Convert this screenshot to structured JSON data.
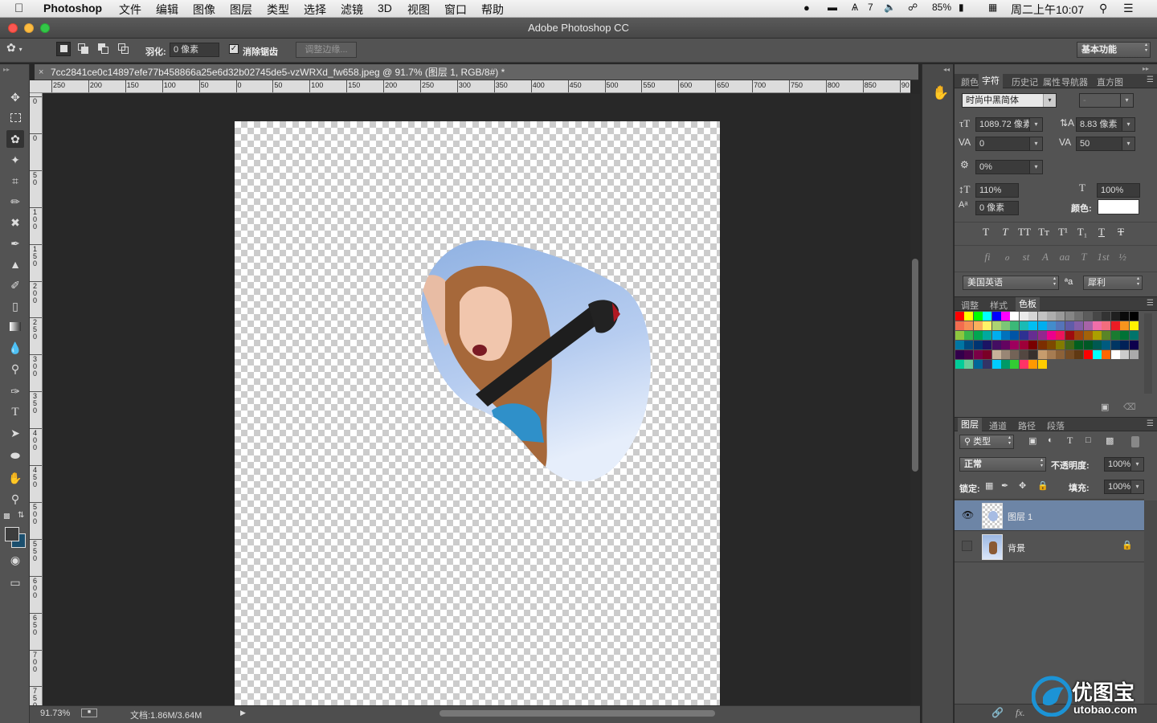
{
  "menubar": {
    "app_name": "Photoshop",
    "menus": [
      "文件",
      "编辑",
      "图像",
      "图层",
      "类型",
      "选择",
      "滤镜",
      "3D",
      "视图",
      "窗口",
      "帮助"
    ],
    "input_method": "7",
    "battery": "85%",
    "clock": "周二上午10:07"
  },
  "window": {
    "title": "Adobe Photoshop CC"
  },
  "options": {
    "feather_label": "羽化:",
    "feather_value": "0 像素",
    "antialias_label": "消除锯齿",
    "refine_edge_label": "调整边缘...",
    "workspace": "基本功能"
  },
  "document": {
    "tab_title": "7cc2841ce0c14897efe77b458866a25e6d32b02745de5-vzWRXd_fw658.jpeg @ 91.7% (图层 1, RGB/8#) *",
    "zoom": "91.73%",
    "doc_size": "文档:1.86M/3.64M"
  },
  "ruler": {
    "h_ticks": [
      "250",
      "200",
      "150",
      "100",
      "50",
      "0",
      "50",
      "100",
      "150",
      "200",
      "250",
      "300",
      "350",
      "400",
      "450",
      "500",
      "550",
      "600",
      "650",
      "700",
      "750",
      "800",
      "850",
      "90"
    ],
    "v_ticks": [
      "0",
      "0",
      "5\n0",
      "1\n0\n0",
      "1\n5\n0",
      "2\n0\n0",
      "2\n5\n0",
      "3\n0\n0",
      "3\n5\n0",
      "4\n0\n0",
      "4\n5\n0",
      "5\n0\n0",
      "5\n5\n0",
      "6\n0\n0",
      "6\n5\n0",
      "7\n0\n0",
      "7\n5\n0"
    ]
  },
  "character_panel": {
    "tabs": [
      "颜色",
      "字符",
      "历史记",
      "属性",
      "导航器",
      "直方图"
    ],
    "font_family": "时尚中黑简体",
    "font_style": "-",
    "font_size": "1089.72 像素",
    "leading": "8.83 像素",
    "kerning": "0",
    "tracking": "50",
    "tsume": "0%",
    "vertical_scale": "110%",
    "horizontal_scale": "100%",
    "baseline_shift": "0 像素",
    "color_label": "颜色:",
    "text_color": "#ffffff",
    "style_buttons": [
      "T",
      "T",
      "TT",
      "Tт",
      "T¹",
      "T₁",
      "T",
      "T"
    ],
    "opentype_buttons": [
      "fi",
      "ℴ",
      "st",
      "A",
      "aa",
      "T",
      "1st",
      "½"
    ],
    "language": "美国英语",
    "aa_icon": "ªa",
    "antialias": "犀利"
  },
  "swatches_panel": {
    "tabs": [
      "调整",
      "样式",
      "色板"
    ],
    "colors": [
      [
        "#ff0000",
        "#ffff00",
        "#00ff00",
        "#00ffff",
        "#0000ff",
        "#ff00ff",
        "#ffffff",
        "#ebebeb",
        "#d6d6d6",
        "#c2c2c2",
        "#adadad",
        "#999999",
        "#858585",
        "#707070",
        "#5c5c5c",
        "#474747",
        "#333333",
        "#1f1f1f",
        "#0a0a0a",
        "#000000"
      ],
      [
        "#f26c4f",
        "#f68e55",
        "#fbaf5c",
        "#fff467",
        "#acd372",
        "#7cc576",
        "#3bb878",
        "#1abbb4",
        "#00bff3",
        "#00aeef",
        "#438ccb",
        "#5574b9",
        "#605ca8",
        "#855fa8",
        "#a763a8",
        "#f06ea9",
        "#f26d7d",
        "#ed1c24",
        "#f7941d",
        "#fff200"
      ],
      [
        "#8dc63f",
        "#39b54a",
        "#00a651",
        "#00a99d",
        "#00aeef",
        "#0072bc",
        "#0054a6",
        "#2e3192",
        "#662d91",
        "#92278f",
        "#ec008c",
        "#ed145b",
        "#9e0b0f",
        "#a0410d",
        "#a36209",
        "#aba000",
        "#598527",
        "#197b30",
        "#007236",
        "#00746b"
      ],
      [
        "#0076a3",
        "#004b80",
        "#003471",
        "#1b1464",
        "#440e62",
        "#630460",
        "#9e005d",
        "#9e0039",
        "#790000",
        "#7b2e00",
        "#7d4900",
        "#827b00",
        "#406618",
        "#005e20",
        "#005826",
        "#005952",
        "#005b7f",
        "#003663",
        "#002157",
        "#0d004c"
      ],
      [
        "#32004b",
        "#4b0049",
        "#7b0046",
        "#7a0026",
        "#c7b299",
        "#998675",
        "#736357",
        "#534741",
        "#37302d",
        "#c69c6d",
        "#a67c52",
        "#8c6239",
        "#754c24",
        "#603913",
        "#ff0000",
        "#00ffff",
        "#ff6600",
        "#ffffff",
        "#cccccc",
        "#aaaaaa"
      ],
      [
        "#00cc99",
        "#66cc99",
        "#006699",
        "#333366",
        "#00ccff",
        "#009966",
        "#33cc33",
        "#ff3366",
        "#ff9900",
        "#ffcc00"
      ]
    ]
  },
  "layers_panel": {
    "tabs": [
      "图层",
      "通道",
      "路径",
      "段落"
    ],
    "filter_kind": "类型",
    "blend_mode": "正常",
    "opacity_label": "不透明度:",
    "opacity": "100%",
    "lock_label": "锁定:",
    "fill_label": "填充:",
    "fill": "100%",
    "layers": [
      {
        "name": "图层 1",
        "visible": true,
        "selected": true
      },
      {
        "name": "背景",
        "visible": false,
        "selected": false,
        "locked": true
      }
    ]
  },
  "watermark": {
    "brand": "优图宝",
    "domain": "utobao.com"
  }
}
